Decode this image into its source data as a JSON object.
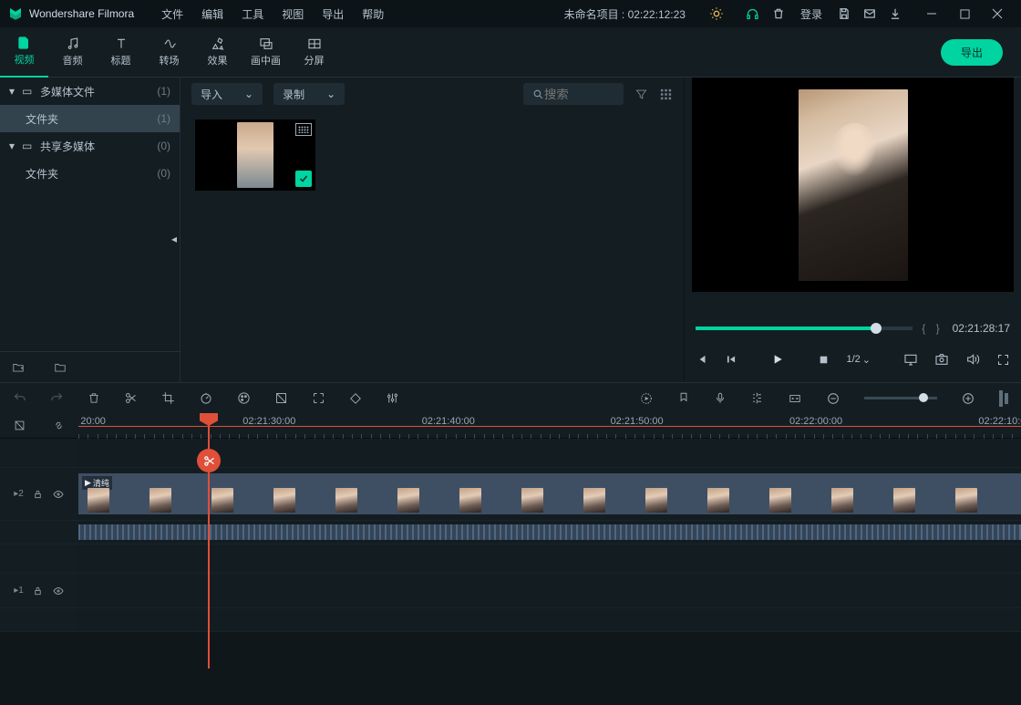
{
  "app": {
    "name": "Wondershare Filmora",
    "project_title": "未命名项目 : 02:22:12:23"
  },
  "menu": {
    "file": "文件",
    "edit": "编辑",
    "tool": "工具",
    "view": "视图",
    "export": "导出",
    "help": "帮助",
    "login": "登录"
  },
  "ribbon": {
    "video": "视频",
    "audio": "音频",
    "title": "标题",
    "transition": "转场",
    "effect": "效果",
    "pip": "画中画",
    "split": "分屏",
    "export_btn": "导出"
  },
  "tree": {
    "multimedia": {
      "label": "多媒体文件",
      "count": "(1)"
    },
    "folder": {
      "label": "文件夹",
      "count": "(1)"
    },
    "shared": {
      "label": "共享多媒体",
      "count": "(0)"
    },
    "shared_folder": {
      "label": "文件夹",
      "count": "(0)"
    }
  },
  "media_toolbar": {
    "import": "导入",
    "record": "录制",
    "search_placeholder": "搜索"
  },
  "preview": {
    "time": "02:21:28:17",
    "brackets": "{    }",
    "ratio": "1/2"
  },
  "ruler": {
    "labels": [
      "20:00",
      "02:21:30:00",
      "02:21:40:00",
      "02:21:50:00",
      "02:22:00:00",
      "02:22:10:0"
    ],
    "positions": [
      0.5,
      18,
      37,
      57,
      76,
      96
    ]
  },
  "tracks": {
    "t2": "2",
    "t1": "1"
  },
  "clip": {
    "title": "清纯"
  }
}
